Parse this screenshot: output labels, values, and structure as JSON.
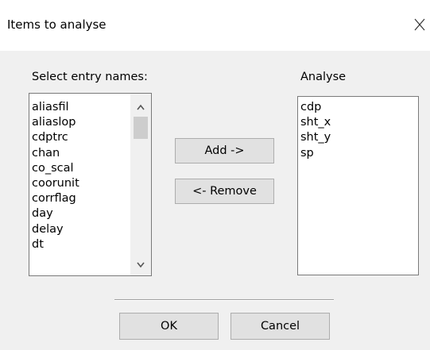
{
  "window": {
    "title": "Items to analyse",
    "close_icon": "close-icon"
  },
  "left": {
    "label": "Select entry names:",
    "items": [
      "aliasfil",
      "aliaslop",
      "cdptrc",
      "chan",
      "co_scal",
      "coorunit",
      "corrflag",
      "day",
      "delay",
      "dt"
    ]
  },
  "right": {
    "label": "Analyse",
    "items": [
      "cdp",
      "sht_x",
      "sht_y",
      "sp"
    ]
  },
  "buttons": {
    "add": "Add ->",
    "remove": "<- Remove",
    "ok": "OK",
    "cancel": "Cancel"
  }
}
